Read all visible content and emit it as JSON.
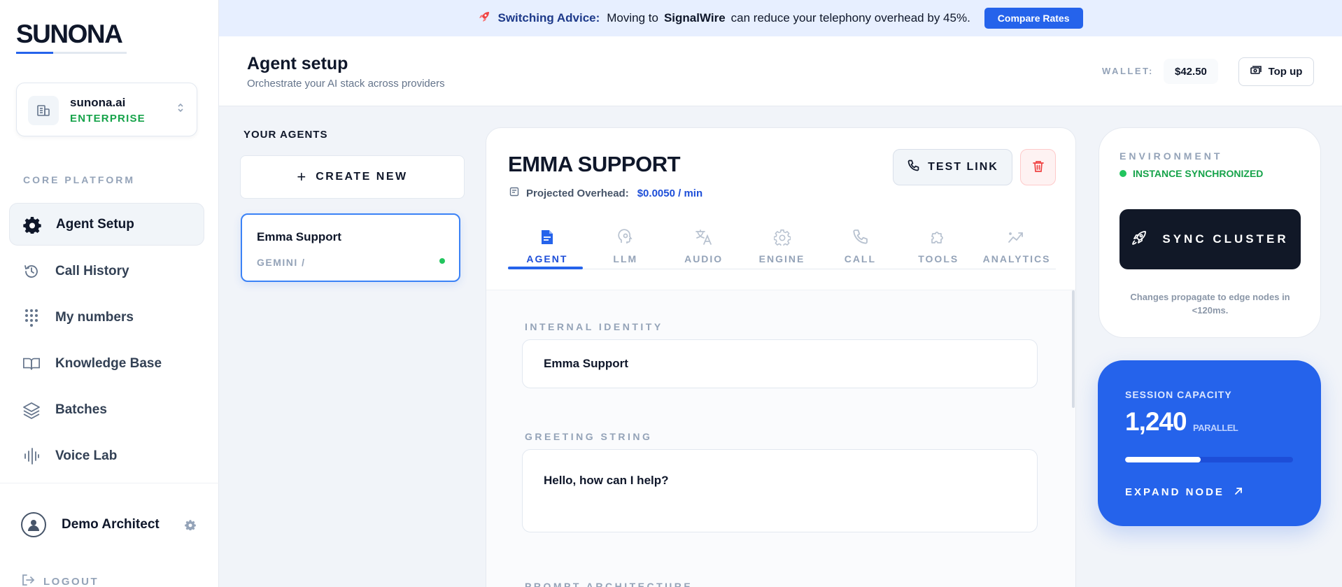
{
  "sidebar": {
    "logo": "SUNONA",
    "org": {
      "name": "sunona.ai",
      "plan": "ENTERPRISE"
    },
    "section_label": "CORE PLATFORM",
    "items": [
      {
        "label": "Agent Setup",
        "icon": "gear-icon",
        "active": true
      },
      {
        "label": "Call History",
        "icon": "history-icon"
      },
      {
        "label": "My numbers",
        "icon": "dialpad-icon"
      },
      {
        "label": "Knowledge Base",
        "icon": "book-icon"
      },
      {
        "label": "Batches",
        "icon": "layers-icon"
      },
      {
        "label": "Voice Lab",
        "icon": "waveform-icon"
      }
    ],
    "user": {
      "name": "Demo Architect"
    },
    "logout_label": "LOGOUT"
  },
  "banner": {
    "lead": "Switching Advice:",
    "text1": "Moving to",
    "brand": "SignalWire",
    "text2": "can reduce your telephony overhead by 45%.",
    "button": "Compare Rates"
  },
  "header": {
    "title": "Agent setup",
    "subtitle": "Orchestrate your AI stack across providers",
    "wallet_label": "WALLET:",
    "wallet_value": "$42.50",
    "topup_label": "Top up"
  },
  "agents": {
    "label": "YOUR AGENTS",
    "create_label": "CREATE NEW",
    "list": [
      {
        "name": "Emma Support",
        "model": "GEMINI /",
        "status_color": "#22c55e"
      }
    ]
  },
  "agent_panel": {
    "title": "EMMA SUPPORT",
    "overhead_label": "Projected Overhead:",
    "overhead_value": "$0.0050 / min",
    "test_link_label": "TEST LINK",
    "tabs": [
      {
        "label": "AGENT",
        "icon": "document-icon",
        "active": true
      },
      {
        "label": "LLM",
        "icon": "brain-icon"
      },
      {
        "label": "AUDIO",
        "icon": "translate-icon"
      },
      {
        "label": "ENGINE",
        "icon": "cog-icon"
      },
      {
        "label": "CALL",
        "icon": "phone-icon"
      },
      {
        "label": "TOOLS",
        "icon": "puzzle-icon"
      },
      {
        "label": "ANALYTICS",
        "icon": "trend-icon"
      }
    ],
    "fields": {
      "identity_label": "INTERNAL IDENTITY",
      "identity_value": "Emma Support",
      "greeting_label": "GREETING STRING",
      "greeting_value": "Hello, how can I help?",
      "prompt_label": "PROMPT ARCHITECTURE"
    }
  },
  "environment": {
    "label": "ENVIRONMENT",
    "status": "INSTANCE SYNCHRONIZED",
    "sync_label": "SYNC CLUSTER",
    "note": "Changes propagate to edge nodes in <120ms."
  },
  "capacity": {
    "label": "SESSION CAPACITY",
    "value": "1,240",
    "unit": "PARALLEL",
    "fill_fraction": 0.45,
    "expand_label": "EXPAND NODE"
  },
  "colors": {
    "accent": "#2563eb",
    "success": "#22c55e",
    "danger": "#ef4444",
    "dark": "#111827"
  }
}
